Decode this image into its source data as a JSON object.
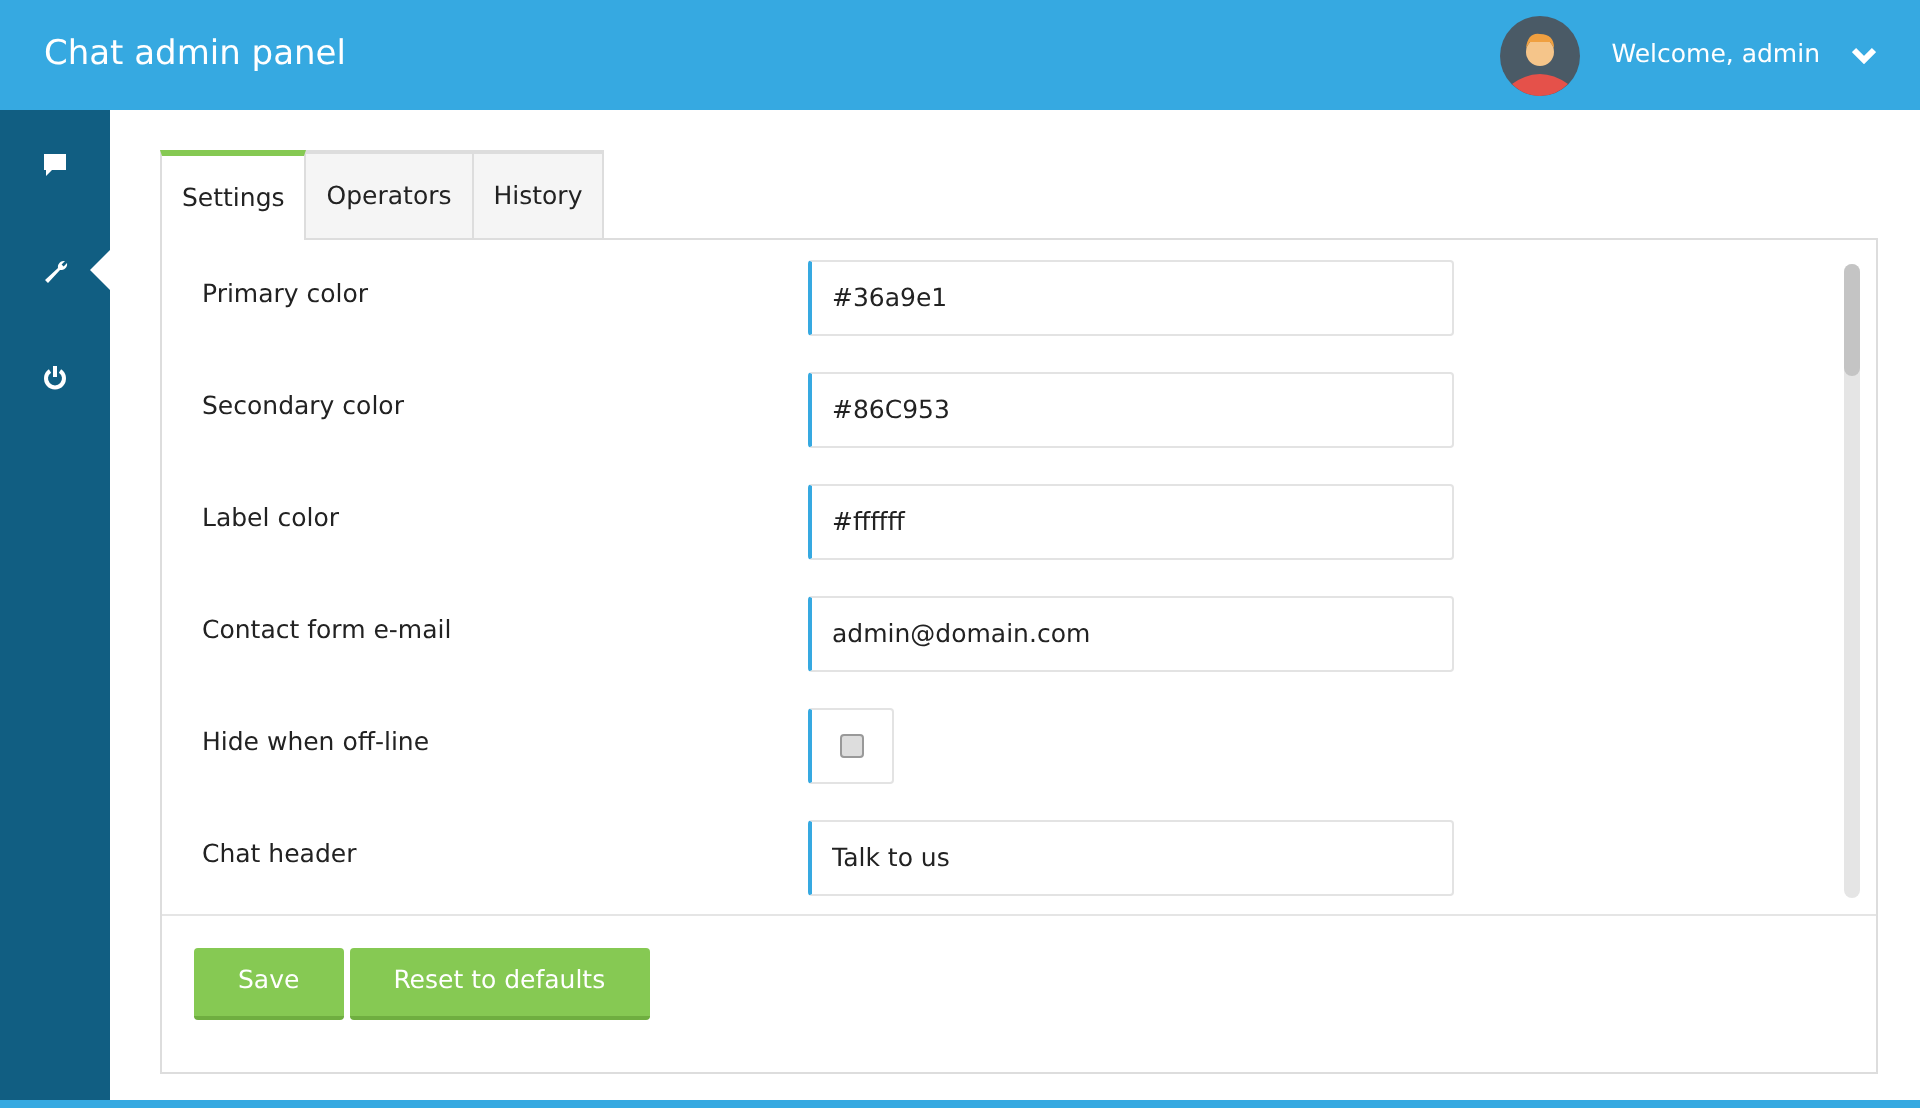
{
  "header": {
    "title": "Chat admin panel",
    "user": "Welcome, admin"
  },
  "sidebar": {
    "items": [
      {
        "kind": "chat",
        "selected": false
      },
      {
        "kind": "settings",
        "selected": true
      },
      {
        "kind": "power",
        "selected": false
      }
    ]
  },
  "tabs": [
    {
      "label": "Settings",
      "selected": true
    },
    {
      "label": "Operators",
      "selected": false
    },
    {
      "label": "History",
      "selected": false
    }
  ],
  "fields": [
    {
      "label": "Primary color",
      "kind": "text",
      "value": "#36a9e1"
    },
    {
      "label": "Secondary color",
      "kind": "text",
      "value": "#86C953"
    },
    {
      "label": "Label color",
      "kind": "text",
      "value": "#ffffff"
    },
    {
      "label": "Contact form e-mail",
      "kind": "text",
      "value": "admin@domain.com"
    },
    {
      "label": "Hide when off-line",
      "kind": "checkbox",
      "checked": false
    },
    {
      "label": "Chat header",
      "kind": "text",
      "value": "Talk to us"
    }
  ],
  "buttons": [
    "Save",
    "Reset to defaults"
  ]
}
